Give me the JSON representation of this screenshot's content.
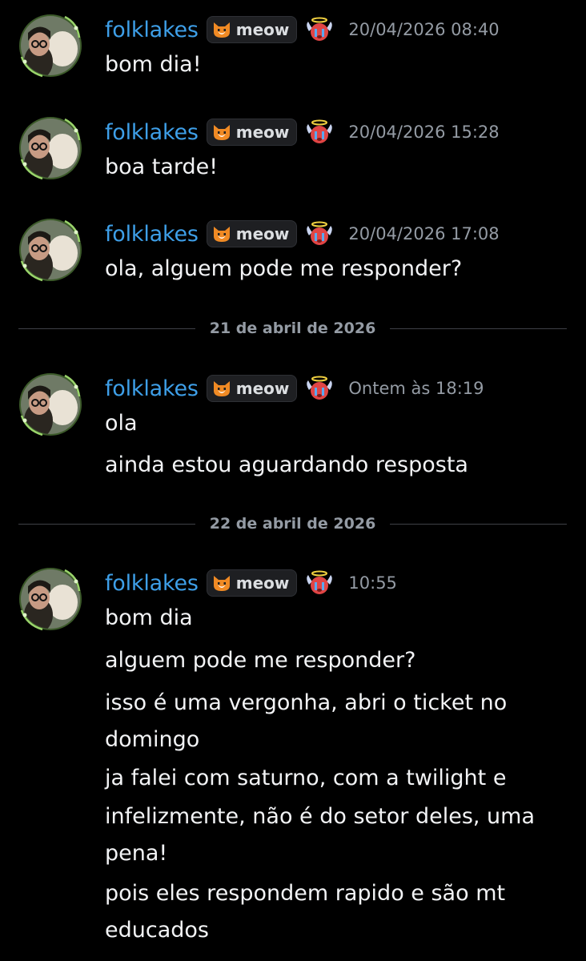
{
  "user": {
    "name": "folklakes",
    "tag_label": "meow"
  },
  "messages": [
    {
      "timestamp": "20/04/2026 08:40",
      "lines": [
        "bom dia!"
      ]
    },
    {
      "timestamp": "20/04/2026 15:28",
      "lines": [
        "boa tarde!"
      ]
    },
    {
      "timestamp": "20/04/2026 17:08",
      "lines": [
        "ola, alguem pode me responder?"
      ]
    },
    {
      "timestamp": "Ontem às 18:19",
      "lines": [
        "ola",
        "ainda estou aguardando resposta"
      ]
    },
    {
      "timestamp": "10:55",
      "lines": [
        "bom dia",
        "alguem pode me responder?",
        "isso é uma vergonha, abri o ticket no",
        "domingo",
        "ja falei com saturno, com a twilight e",
        "infelizmente, não é do setor deles, uma",
        "pena!",
        "pois eles respondem rapido e são mt",
        "educados"
      ]
    }
  ],
  "dividers": [
    "21 de abril de 2026",
    "22 de abril de 2026"
  ],
  "icons": {
    "avatar": "avatar-photo-icon",
    "tag": "cat-face-icon",
    "badge": "angel-crying-face-icon"
  },
  "colors": {
    "background": "#000000",
    "username": "#3e9fe8",
    "timestamp": "#949ba4",
    "message_text": "#f2f3f5",
    "divider_line": "#3f4147"
  }
}
